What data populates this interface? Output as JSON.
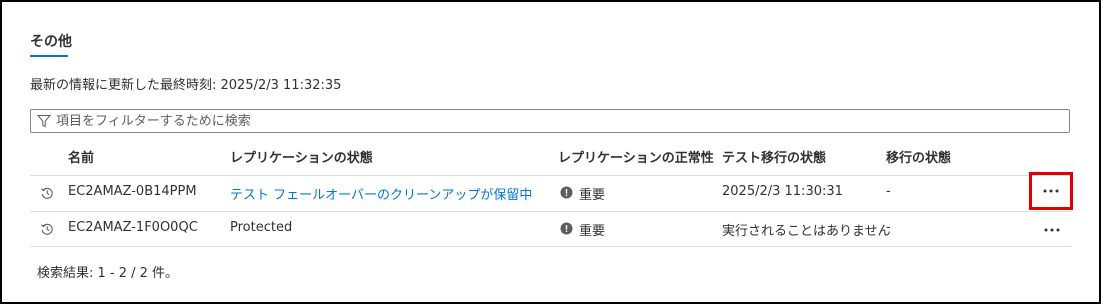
{
  "section": {
    "title": "その他",
    "accent_color": "#0078d4"
  },
  "last_updated": {
    "label": "最新の情報に更新した最終時刻: 2025/2/3 11:32:35"
  },
  "filter": {
    "placeholder": "項目をフィルターするために検索",
    "value": "",
    "icon": "filter-icon"
  },
  "table": {
    "columns": [
      "名前",
      "レプリケーションの状態",
      "レプリケーションの正常性",
      "テスト移行の状態",
      "移行の状態"
    ],
    "rows": [
      {
        "name": "EC2AMAZ-0B14PPM",
        "replication_status": "テスト フェールオーバーのクリーンアップが保留中",
        "replication_health": "重要",
        "test_migration_status": "2025/2/3 11:30:31",
        "migration_status": "-",
        "more_icon": "more-horizontal-icon"
      },
      {
        "name": "EC2AMAZ-1F0O0QC",
        "replication_status": "Protected",
        "replication_health": "重要",
        "test_migration_status": "実行されることはありません",
        "migration_status": "-",
        "more_icon": "more-horizontal-icon"
      }
    ]
  },
  "results": {
    "label": "検索結果: 1 - 2 / 2 件。"
  },
  "colors": {
    "link": "#0078d4",
    "highlight_border": "#e00000",
    "health_icon": "#605e5c"
  }
}
